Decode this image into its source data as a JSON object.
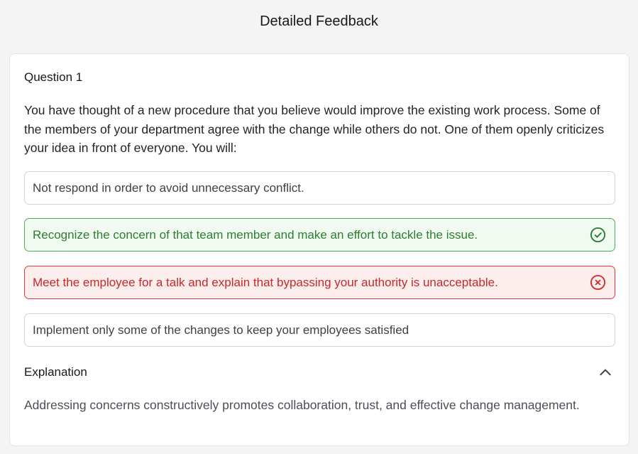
{
  "header": {
    "title": "Detailed Feedback"
  },
  "question": {
    "label": "Question 1",
    "text": "You have thought of a new procedure that you believe would improve the existing work process. Some of the members of your department agree with the change while others do not. One of them openly criticizes your idea in front of everyone. You will:",
    "options": [
      {
        "text": "Not respond in order to avoid unnecessary conflict.",
        "state": "neutral"
      },
      {
        "text": "Recognize the concern of that team member and make an effort to tackle the issue.",
        "state": "correct",
        "icon": "check-circle-icon"
      },
      {
        "text": "Meet the employee for a talk and explain that bypassing your authority is unacceptable.",
        "state": "wrong",
        "icon": "x-circle-icon"
      },
      {
        "text": "Implement only some of the changes to keep your employees satisfied",
        "state": "neutral"
      }
    ]
  },
  "explanation": {
    "title": "Explanation",
    "toggle_icon": "chevron-up-icon",
    "text": "Addressing concerns constructively promotes collaboration, trust, and effective change management."
  },
  "colors": {
    "correct": "#2e7d32",
    "correct_bg": "#f0faf0",
    "wrong": "#c62828",
    "wrong_bg": "#fdeeee"
  }
}
